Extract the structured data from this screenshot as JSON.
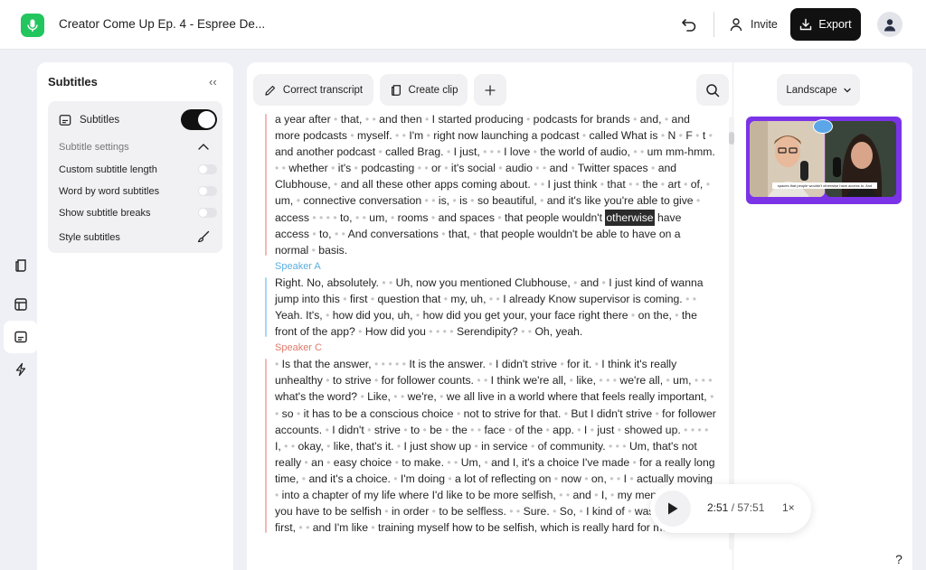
{
  "header": {
    "project_title": "Creator Come Up Ep. 4 - Espree De...",
    "invite_label": "Invite",
    "export_label": "Export"
  },
  "subtitles_panel": {
    "title": "Subtitles",
    "collapse_glyph": "‹‹",
    "subtitles_label": "Subtitles",
    "subtitles_enabled": true,
    "settings_label": "Subtitle settings",
    "options": [
      {
        "label": "Custom subtitle length",
        "enabled": false
      },
      {
        "label": "Word by word subtitles",
        "enabled": false
      },
      {
        "label": "Show subtitle breaks",
        "enabled": false
      }
    ],
    "style_label": "Style subtitles"
  },
  "toolbar": {
    "correct_label": "Correct transcript",
    "clip_label": "Create clip",
    "layout_label": "Landscape"
  },
  "transcript": {
    "highlighted_word": "otherwise",
    "block1_before": "a year after • that, • • and then • I started producing • podcasts for brands • and, • and more podcasts • myself. • • I'm • right now launching a podcast • called What is • N • F • t • and another podcast • called Brag. • I just, • • • I love • the world of audio, • • um mm-hmm. • • whether • it's • podcasting • • or • it's social • audio • • and • Twitter spaces • and Clubhouse, • and all these other apps coming about. • • I just think • that • • the • art • of, • um, • connective conversation • • is, • is • so beautiful, • and it's like you're able to give • access • • • • to, • • um, • rooms • and spaces • that people wouldn't",
    "block1_after": "have access • to, • • And conversations • that, • that people wouldn't be able to have on a normal • basis.",
    "speaker_a": "Speaker A",
    "block2": "Right. No, absolutely. • • Uh, now you mentioned Clubhouse, • and • I just kind of wanna jump into this • first • question that • my, uh, • • I already Know supervisor is coming. • • Yeah. It's, • how did you, uh, • how did you get your, your face right there • on the, • the front of the app? • How did you • • • • Serendipity? • • Oh, yeah.",
    "speaker_c": "Speaker C",
    "block3": "• Is that the answer, • • • • • It is the answer. • I didn't strive • for it. • I think it's really unhealthy • to strive • for follower counts. • • I think we're all, • like, • • • we're all, • um, • • • what's the word? • Like, • • we're, • we all live in a world where that feels really important, • • so • it has to be a conscious choice • not to strive for that. • But I didn't strive • for follower accounts. • I didn't • strive • to • be • the • • face • of the • app. • I • just • showed up. • • • • I, • • okay, • like, that's it. • I just show up • in service • of community. • • • Um, that's not really • an • easy choice • to make. • • Um, • and I, it's a choice I've made • for a really long time, • and it's a choice. • I'm doing • a lot of reflecting on • now • on, • • I • actually moving • into a chapter of my life where I'd like to be more selfish, • • and • I, • my mentor • says, you have to be selfish • in order • to be selfless. • • Sure. • So, • I kind of • was selfless first, • • and I'm like • training myself how to be selfish, which is really hard for me."
  },
  "preview": {
    "caption": "spaces that people wouldn't otherwise have access to. And"
  },
  "player": {
    "current_time": "2:51",
    "separator": " / ",
    "total_time": "57:51",
    "speed": "1×"
  },
  "help_label": "?"
}
